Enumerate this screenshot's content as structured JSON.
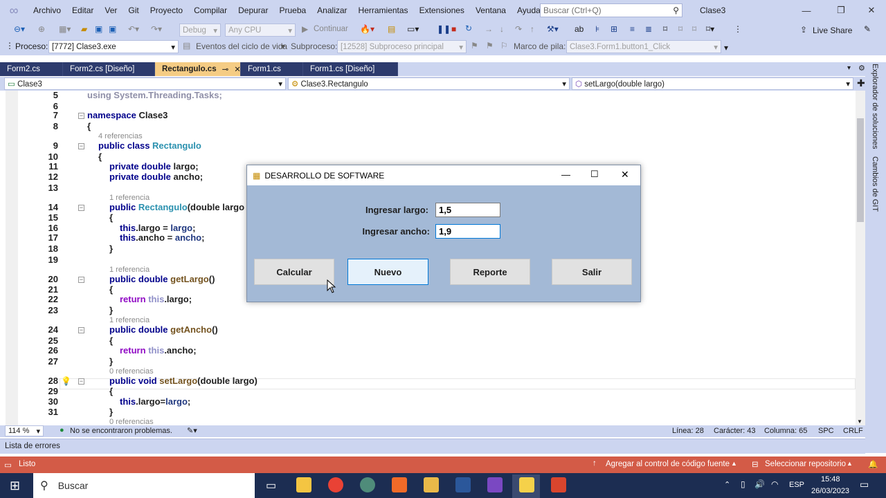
{
  "menubar": {
    "items": [
      "Archivo",
      "Editar",
      "Ver",
      "Git",
      "Proyecto",
      "Compilar",
      "Depurar",
      "Prueba",
      "Analizar",
      "Herramientas",
      "Extensiones",
      "Ventana",
      "Ayuda"
    ],
    "search_placeholder": "Buscar (Ctrl+Q)",
    "solution_name": "Clase3"
  },
  "toolbar": {
    "config": "Debug",
    "platform": "Any CPU",
    "continue_label": "Continuar",
    "live_share": "Live Share",
    "process_label": "Proceso:",
    "process_value": "[7772] Clase3.exe",
    "lifecycle_label": "Eventos del ciclo de vida",
    "thread_label": "Subproceso:",
    "thread_value": "[12528] Subproceso principal",
    "stack_label": "Marco de pila:",
    "stack_value": "Clase3.Form1.button1_Click"
  },
  "tabs": [
    {
      "label": "Form2.cs"
    },
    {
      "label": "Form2.cs [Diseño]"
    },
    {
      "label": "Rectangulo.cs",
      "active": true
    },
    {
      "label": "Form1.cs"
    },
    {
      "label": "Form1.cs [Diseño]"
    }
  ],
  "navbar": {
    "project": "Clase3",
    "type": "Clase3.Rectangulo",
    "member": "setLargo(double largo)"
  },
  "code": {
    "l5": "using System.Threading.Tasks;",
    "l7a": "namespace",
    "l7b": "Clase3",
    "l8": "{",
    "ref4": "4 referencias",
    "l9a": "public class",
    "l9b": "Rectangulo",
    "l10": "{",
    "l11a": "private double",
    "l11b": "largo;",
    "l12a": "private double",
    "l12b": "ancho;",
    "ref1a": "1 referencia",
    "l14a": "public",
    "l14b": "Rectangulo",
    "l14c": "(double largo",
    "l15": "{",
    "l16a": "this",
    "l16b": ".largo = ",
    "l16c": "largo",
    "l16d": ";",
    "l17a": "this",
    "l17b": ".ancho = ",
    "l17c": "ancho",
    "l17d": ";",
    "l18": "}",
    "ref1b": "1 referencia",
    "l20a": "public double",
    "l20b": "getLargo",
    "l20c": "()",
    "l21": "{",
    "l22a": "return",
    "l22b": "this",
    "l22c": ".largo;",
    "l23": "}",
    "ref1c": "1 referencia",
    "l24a": "public double",
    "l24b": "getAncho",
    "l24c": "()",
    "l25": "{",
    "l26a": "return",
    "l26b": "this",
    "l26c": ".ancho;",
    "l27": "}",
    "ref0a": "0 referencias",
    "l28a": "public void",
    "l28b": "setLargo",
    "l28c": "(double largo)",
    "l29": "{",
    "l30a": "this",
    "l30b": ".largo=",
    "l30c": "largo",
    "l30d": ";",
    "l31": "}",
    "ref0b": "0 referencias",
    "line_numbers": [
      "5",
      "6",
      "7",
      "8",
      "9",
      "10",
      "11",
      "12",
      "13",
      "14",
      "15",
      "16",
      "17",
      "18",
      "19",
      "20",
      "21",
      "22",
      "23",
      "24",
      "25",
      "26",
      "27",
      "28",
      "29",
      "30",
      "31"
    ]
  },
  "statusbar": {
    "zoom": "114 %",
    "problems": "No se encontraron problemas.",
    "line": "Línea: 28",
    "char": "Carácter: 43",
    "column": "Columna: 65",
    "spc": "SPC",
    "crlf": "CRLF"
  },
  "right_panel": {
    "explorer": "Explorador de soluciones",
    "git": "Cambios de GIT"
  },
  "error_list": "Lista de errores",
  "vs_status": {
    "ready": "Listo",
    "source_control": "Agregar al control de código fuente",
    "repo": "Seleccionar repositorio"
  },
  "taskbar": {
    "search": "Buscar",
    "lang": "ESP",
    "time": "15:48",
    "date": "26/03/2023"
  },
  "dialog": {
    "title": "DESARROLLO DE SOFTWARE",
    "largo_label": "Ingresar largo:",
    "largo_value": "1,5",
    "ancho_label": "Ingresar ancho:",
    "ancho_value": "1,9",
    "btn_calcular": "Calcular",
    "btn_nuevo": "Nuevo",
    "btn_reporte": "Reporte",
    "btn_salir": "Salir"
  }
}
